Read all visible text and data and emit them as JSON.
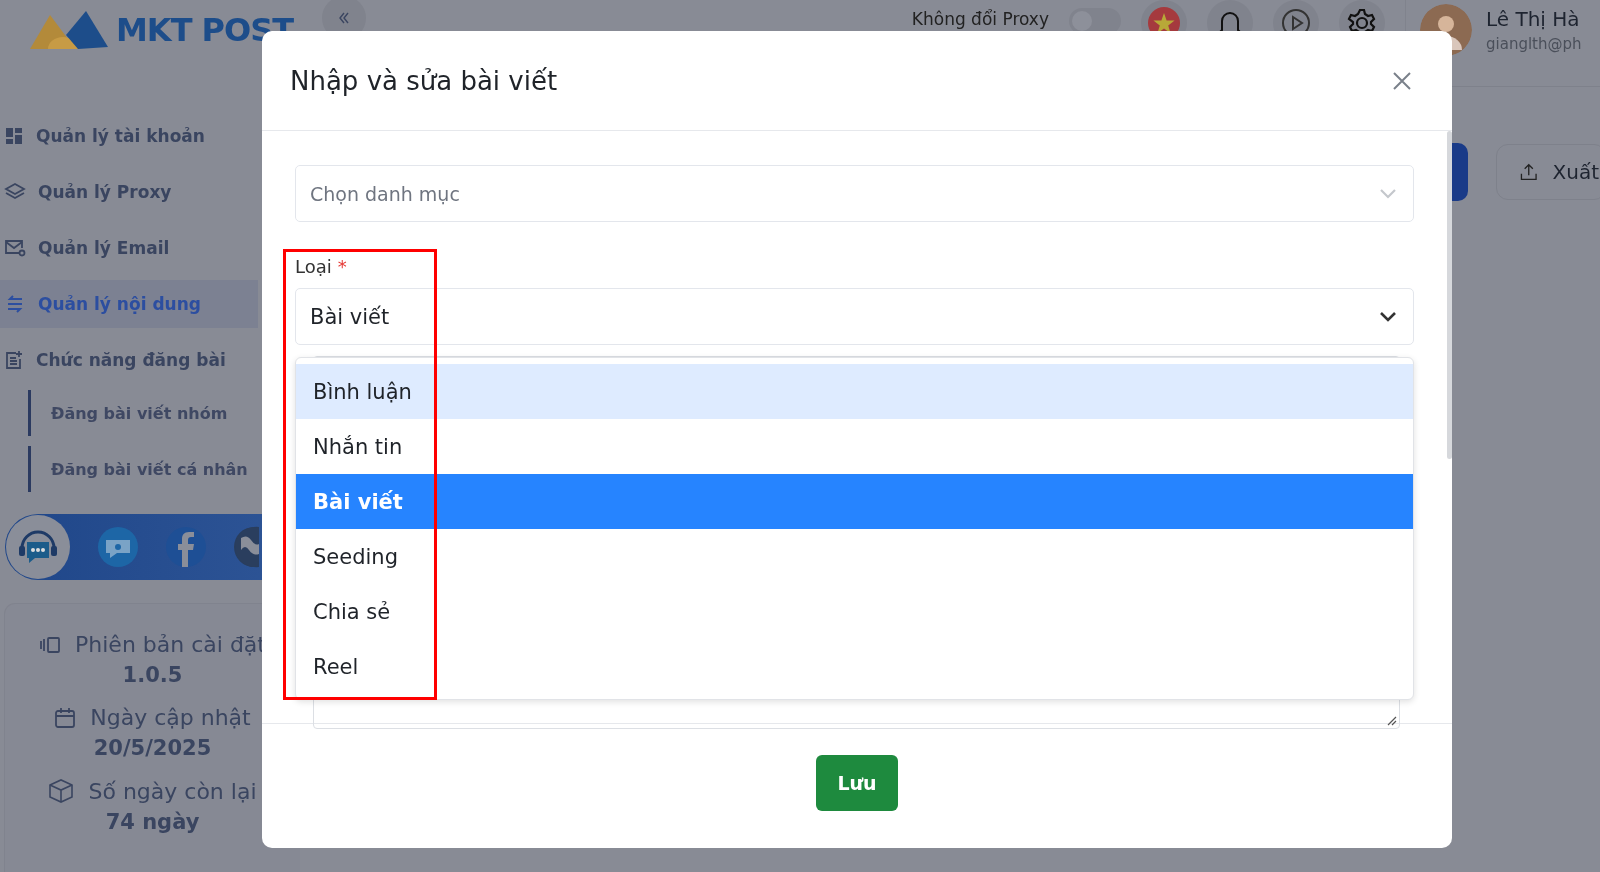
{
  "logo": {
    "text": "MKT POST"
  },
  "sidebar": {
    "items": [
      {
        "label": "Quản lý tài khoản",
        "selected": false
      },
      {
        "label": "Quản lý Proxy",
        "selected": false
      },
      {
        "label": "Quản lý Email",
        "selected": false
      },
      {
        "label": "Quản lý nội dung",
        "selected": true
      },
      {
        "label": "Chức năng đăng bài",
        "selected": false,
        "children": [
          {
            "label": "Đăng bài viết nhóm",
            "selected": false
          },
          {
            "label": "Đăng bài viết cá nhân",
            "selected": false
          }
        ]
      }
    ]
  },
  "info": [
    {
      "label": "Phiên bản cài đặt",
      "value": "1.0.5"
    },
    {
      "label": "Ngày cập nhật",
      "value": "20/5/2025"
    },
    {
      "label": "Số ngày còn lại",
      "value": "74 ngày"
    }
  ],
  "topbar": {
    "proxy_toggle": {
      "label": "Không đổi Proxy",
      "on": false
    },
    "user": {
      "name": "Lê Thị Hà",
      "email": "gianglth@ph"
    }
  },
  "toolbar": {
    "export_button": "Xuất"
  },
  "modal": {
    "title": "Nhập và sửa bài viết",
    "category": {
      "placeholder": "Chọn danh mục"
    },
    "type_field": {
      "label": "Loại",
      "required": true,
      "required_mark": "*",
      "value": "Bài viết",
      "options": [
        {
          "label": "Bình luận",
          "highlighted": true,
          "selected": false
        },
        {
          "label": "Nhắn tin",
          "highlighted": false,
          "selected": false
        },
        {
          "label": "Bài viết",
          "highlighted": false,
          "selected": true
        },
        {
          "label": "Seeding",
          "highlighted": false,
          "selected": false
        },
        {
          "label": "Chia sẻ",
          "highlighted": false,
          "selected": false
        },
        {
          "label": "Reel",
          "highlighted": false,
          "selected": false
        }
      ]
    },
    "save_button": "Lưu"
  }
}
